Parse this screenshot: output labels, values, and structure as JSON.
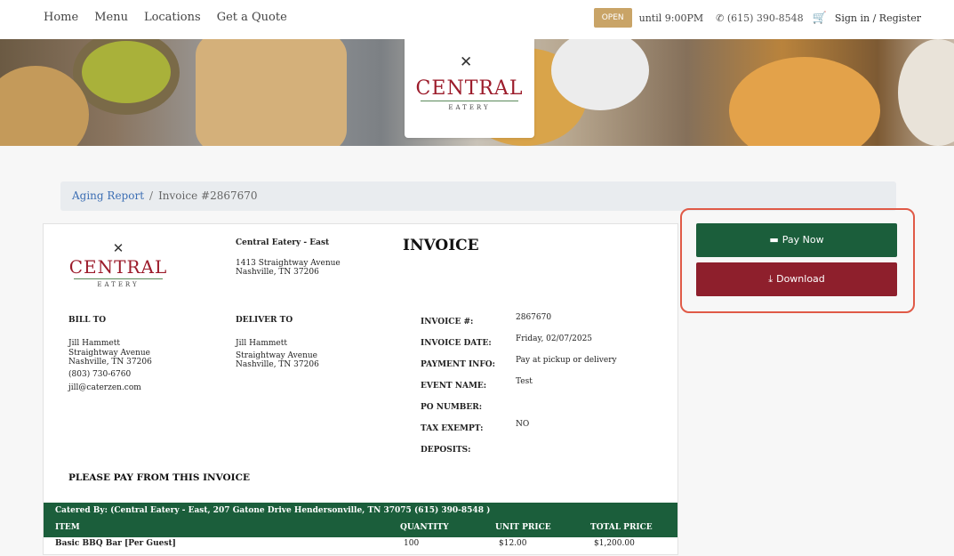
{
  "nav": {
    "links": [
      "Home",
      "Menu",
      "Locations",
      "Get a Quote"
    ],
    "status": "OPEN",
    "hours": "until 9:00PM",
    "phone": "(615) 390-8548",
    "signin": "Sign in / Register"
  },
  "brand": {
    "name": "CENTRAL",
    "sub": "EATERY"
  },
  "breadcrumb": {
    "parent": "Aging Report",
    "separator": "/",
    "current": "Invoice #2867670"
  },
  "invoice": {
    "title": "INVOICE",
    "from": {
      "name": "Central Eatery - East",
      "address1": "1413 Straightway Avenue",
      "address2": "Nashville, TN 37206"
    },
    "bill_to": {
      "heading": "BILL TO",
      "name": "Jill Hammett",
      "address1": "Straightway Avenue",
      "address2": "Nashville, TN 37206",
      "phone": "(803) 730-6760",
      "email": "jill@caterzen.com"
    },
    "deliver_to": {
      "heading": "DELIVER TO",
      "name": "Jill Hammett",
      "address1": "Straightway Avenue",
      "address2": "Nashville, TN 37206"
    },
    "details": [
      {
        "label": "INVOICE #:",
        "value": "2867670"
      },
      {
        "label": "INVOICE DATE:",
        "value": "Friday, 02/07/2025"
      },
      {
        "label": "PAYMENT INFO:",
        "value": "Pay at pickup or delivery"
      },
      {
        "label": "EVENT NAME:",
        "value": "Test"
      },
      {
        "label": "PO NUMBER:",
        "value": ""
      },
      {
        "label": "TAX EXEMPT:",
        "value": "NO"
      },
      {
        "label": "DEPOSITS:",
        "value": ""
      }
    ],
    "pay_from": "PLEASE PAY FROM THIS INVOICE",
    "catered_by": "Catered By: (Central Eatery - East, 207 Gatone Drive Hendersonville, TN 37075 (615) 390-8548 )",
    "columns": [
      "ITEM",
      "QUANTITY",
      "UNIT PRICE",
      "TOTAL PRICE"
    ],
    "rows": [
      {
        "item": "Basic BBQ Bar [Per Guest]",
        "quantity": "100",
        "unit_price": "$12.00",
        "total": "$1,200.00"
      }
    ]
  },
  "actions": {
    "pay": "Pay Now",
    "download": "Download"
  },
  "colors": {
    "green": "#1b5e3b",
    "maroon": "#8e1f2c",
    "gold": "#c9a467",
    "highlight": "#e05a47"
  }
}
